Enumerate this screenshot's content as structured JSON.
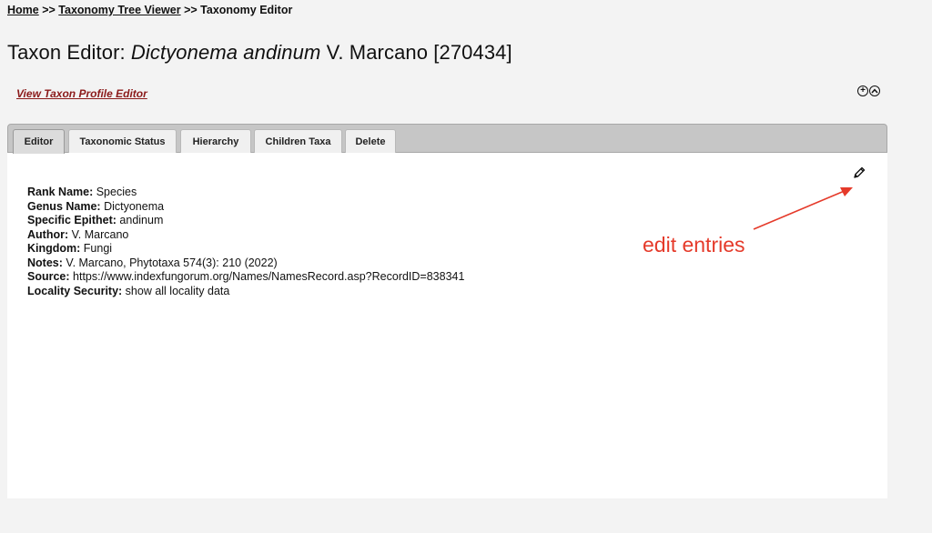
{
  "breadcrumb": {
    "home": "Home",
    "sep1": " >> ",
    "tree_viewer": "Taxonomy Tree Viewer",
    "sep2": " >> ",
    "current": "Taxonomy Editor"
  },
  "title": {
    "prefix": "Taxon Editor: ",
    "taxon_italic": "Dictyonema andinum",
    "suffix": " V. Marcano [270434]"
  },
  "profile_link": "View Taxon Profile Editor",
  "toggle_icons": [
    "plus-circle-icon",
    "chevron-up-circle-icon"
  ],
  "tabs": [
    {
      "label": "Editor",
      "active": true
    },
    {
      "label": "Taxonomic Status",
      "active": false
    },
    {
      "label": "Hierarchy",
      "active": false
    },
    {
      "label": "Children Taxa",
      "active": false
    },
    {
      "label": "Delete",
      "active": false
    }
  ],
  "fields": [
    {
      "label": "Rank Name:",
      "value": " Species"
    },
    {
      "label": "Genus Name:",
      "value": " Dictyonema"
    },
    {
      "label": "Specific Epithet:",
      "value": " andinum"
    },
    {
      "label": "Author:",
      "value": " V. Marcano"
    },
    {
      "label": "Kingdom:",
      "value": " Fungi"
    },
    {
      "label": "Notes:",
      "value": " V. Marcano, Phytotaxa 574(3): 210 (2022)"
    },
    {
      "label": "Source:",
      "value": " https://www.indexfungorum.org/Names/NamesRecord.asp?RecordID=838341"
    },
    {
      "label": "Locality Security:",
      "value": " show all locality data"
    }
  ],
  "edit_icon": "pencil-icon",
  "annotation": {
    "text": "edit entries",
    "color": "#e53a2a"
  },
  "colors": {
    "link_red": "#8b1a1a",
    "tabbar": "#c6c6c6",
    "background": "#f3f3f3"
  }
}
